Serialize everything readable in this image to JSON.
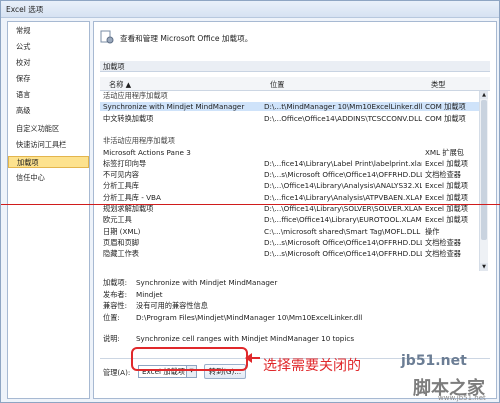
{
  "window": {
    "title": "Excel 选项"
  },
  "sidebar": {
    "items": [
      {
        "label": "常规"
      },
      {
        "label": "公式"
      },
      {
        "label": "校对"
      },
      {
        "label": "保存"
      },
      {
        "label": "语言"
      },
      {
        "label": "高级"
      },
      {
        "label": "自定义功能区"
      },
      {
        "label": "快速访问工具栏"
      },
      {
        "label": "加载项",
        "selected": true
      },
      {
        "label": "信任中心"
      }
    ]
  },
  "header": {
    "text": "查看和管理 Microsoft Office 加载项。"
  },
  "section_title": "加载项",
  "table": {
    "columns": [
      "名称 ▲",
      "位置",
      "类型"
    ],
    "rows": [
      {
        "group": true,
        "name": "活动应用程序加载项",
        "location": "",
        "type": ""
      },
      {
        "name": "Synchronize with Mindjet MindManager",
        "location": "D:\\...t\\MindManager 10\\Mm10ExcelLinker.dll",
        "type": "COM 加载项",
        "selected": true
      },
      {
        "name": "中文转换加载项",
        "location": "D:\\...Office\\Office14\\ADDINS\\TCSCCONV.DLL",
        "type": "COM 加载项"
      },
      {
        "group": true,
        "name": "",
        "location": "",
        "type": ""
      },
      {
        "group": true,
        "name": "非活动应用程序加载项",
        "location": "",
        "type": ""
      },
      {
        "name": "Microsoft Actions Pane 3",
        "location": "",
        "type": "XML 扩展包"
      },
      {
        "name": "标签打印向导",
        "location": "D:\\...fice14\\Library\\Label Print\\labelprint.xlam",
        "type": "Excel 加载项"
      },
      {
        "name": "不可见内容",
        "location": "D:\\...s\\Microsoft Office\\Office14\\OFFRHD.DLL",
        "type": "文档检查器"
      },
      {
        "name": "分析工具库",
        "location": "D:\\...\\Office14\\Library\\Analysis\\ANALYS32.XLL",
        "type": "Excel 加载项"
      },
      {
        "name": "分析工具库 - VBA",
        "location": "D:\\...fice14\\Library\\Analysis\\ATPVBAEN.XLAM",
        "type": "Excel 加载项"
      },
      {
        "name": "规划求解加载项",
        "location": "D:\\...\\Office14\\Library\\SOLVER\\SOLVER.XLAM",
        "type": "Excel 加载项"
      },
      {
        "name": "欧元工具",
        "location": "D:\\...ffice\\Office14\\Library\\EUROTOOL.XLAM",
        "type": "Excel 加载项"
      },
      {
        "name": "日期 (XML)",
        "location": "C:\\...\\microsoft shared\\Smart Tag\\MOFL.DLL",
        "type": "操作"
      },
      {
        "name": "页眉和页脚",
        "location": "D:\\...s\\Microsoft Office\\Office14\\OFFRHD.DLL",
        "type": "文档检查器"
      },
      {
        "name": "隐藏工作表",
        "location": "D:\\...s\\Microsoft Office\\Office14\\OFFRHD.DLL",
        "type": "文档检查器"
      }
    ]
  },
  "details": {
    "addin_label": "加载项:",
    "addin": "Synchronize with Mindjet MindManager",
    "publisher_label": "发布者:",
    "publisher": "Mindjet",
    "compat_label": "兼容性:",
    "compat": "没有可用的兼容性信息",
    "location_label": "位置:",
    "location": "D:\\Program Files\\Mindjet\\MindManager 10\\Mm10ExcelLinker.dll",
    "desc_label": "说明:",
    "desc": "Synchronize cell ranges with Mindjet MindManager 10 topics"
  },
  "manage": {
    "label": "管理(A):",
    "selected": "Excel 加载项",
    "go_label": "转到(G)..."
  },
  "annotation": {
    "text": "选择需要关闭的"
  },
  "watermark": {
    "site": "jb51.net",
    "brand": "脚本之家",
    "url": "www.jb51.net"
  },
  "colors": {
    "highlight": "#e0282b",
    "selection": "#fde28e"
  }
}
